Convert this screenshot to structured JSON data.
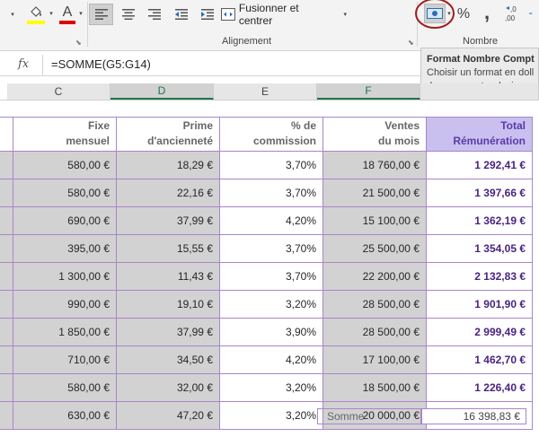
{
  "ribbon": {
    "merge_label": "Fusionner et centrer",
    "alignment_label": "Alignement",
    "number_label": "Nombre",
    "percent_symbol": "%",
    "comma_symbol": ","
  },
  "formula_bar": {
    "fx": "fx",
    "formula": "=SOMME(G5:G14)"
  },
  "tooltip": {
    "title": "Format Nombre Compt",
    "line1": "Choisir un format en doll",
    "line2": "dans une autre devise."
  },
  "columns": [
    "C",
    "D",
    "E",
    "F"
  ],
  "table": {
    "headers": [
      {
        "l1": "Fixe",
        "l2": "mensuel"
      },
      {
        "l1": "Prime",
        "l2": "d'ancienneté"
      },
      {
        "l1": "% de",
        "l2": "commission"
      },
      {
        "l1": "Ventes",
        "l2": "du mois"
      },
      {
        "l1": "Total",
        "l2": "Rémunération"
      }
    ],
    "rows": [
      [
        "580,00 €",
        "18,29 €",
        "3,70%",
        "18 760,00 €",
        "1 292,41 €"
      ],
      [
        "580,00 €",
        "22,16 €",
        "3,70%",
        "21 500,00 €",
        "1 397,66 €"
      ],
      [
        "690,00 €",
        "37,99 €",
        "4,20%",
        "15 100,00 €",
        "1 362,19 €"
      ],
      [
        "395,00 €",
        "15,55 €",
        "3,70%",
        "25 500,00 €",
        "1 354,05 €"
      ],
      [
        "1 300,00 €",
        "11,43 €",
        "3,70%",
        "22 200,00 €",
        "2 132,83 €"
      ],
      [
        "990,00 €",
        "19,10 €",
        "3,20%",
        "28 500,00 €",
        "1 901,90 €"
      ],
      [
        "1 850,00 €",
        "37,99 €",
        "3,90%",
        "28 500,00 €",
        "2 999,49 €"
      ],
      [
        "710,00 €",
        "34,50 €",
        "4,20%",
        "17 100,00 €",
        "1 462,70 €"
      ],
      [
        "580,00 €",
        "32,00 €",
        "3,20%",
        "18 500,00 €",
        "1 226,40 €"
      ],
      [
        "630,00 €",
        "47,20 €",
        "3,20%",
        "20 000,00 €",
        "1 269,20 €"
      ]
    ]
  },
  "summary": {
    "label": "Somme",
    "value": "16 398,83 €"
  },
  "colors": {
    "accent_green": "#217346",
    "border_purple": "#a985c9",
    "total_header_bg": "#c9c0ef",
    "total_text": "#4a2380",
    "highlight_circle": "#a01e1e"
  }
}
